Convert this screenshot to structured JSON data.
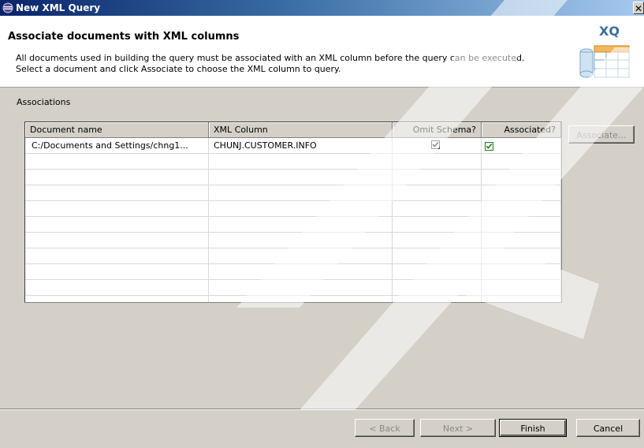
{
  "window": {
    "title": "New XML Query",
    "close_glyph": "✕"
  },
  "header": {
    "title": "Associate documents with XML columns",
    "description_line1": "All documents used in building the query must be associated with an XML column before the query can be executed.",
    "description_line2": "Select a document and click Associate to choose the XML column to query.",
    "banner_label": "XQ"
  },
  "associations": {
    "label": "Associations",
    "columns": [
      "Document name",
      "XML Column",
      "Omit Schema?",
      "Associated?"
    ],
    "rows": [
      {
        "document_name": "C:/Documents and Settings/chng1...",
        "xml_column": "CHUNJ.CUSTOMER.INFO",
        "omit_schema": true,
        "associated": true
      }
    ],
    "empty_rows": 9
  },
  "buttons": {
    "associate": "Associate...",
    "back": "< Back",
    "next": "Next >",
    "finish": "Finish",
    "cancel": "Cancel"
  },
  "colors": {
    "title_bar_start": "#0a246a",
    "dialog_bg": "#d4d0c8",
    "associated_check": "#1c7a1c"
  }
}
